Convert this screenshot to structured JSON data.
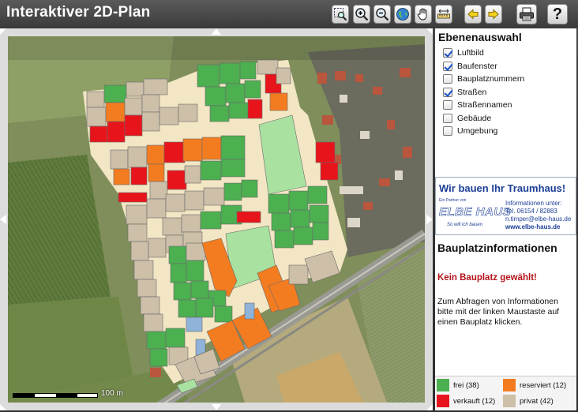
{
  "header": {
    "title": "Interaktiver 2D-Plan",
    "toolbar": [
      {
        "name": "zoom-box",
        "icon": "zoom-rectangle-icon"
      },
      {
        "name": "zoom-in",
        "icon": "zoom-in-icon"
      },
      {
        "name": "zoom-out",
        "icon": "zoom-out-icon"
      },
      {
        "name": "full-extent",
        "icon": "globe-icon"
      },
      {
        "name": "pan",
        "icon": "hand-icon"
      },
      {
        "name": "measure",
        "icon": "ruler-icon"
      },
      {
        "name": "back",
        "icon": "arrow-left-icon"
      },
      {
        "name": "forward",
        "icon": "arrow-right-icon"
      },
      {
        "name": "print",
        "icon": "printer-icon"
      },
      {
        "name": "help",
        "icon": "help-icon",
        "label": "?"
      }
    ]
  },
  "map": {
    "scale_label": "100 m",
    "colors": {
      "frei": "#4caf50",
      "verkauft": "#e8141c",
      "reserviert": "#f47c20",
      "privat": "#cdbfa8",
      "street": "#f3e6c4",
      "green": "#a9e2a0"
    }
  },
  "layers": {
    "title": "Ebenenauswahl",
    "items": [
      {
        "label": "Luftbild",
        "checked": true
      },
      {
        "label": "Baufenster",
        "checked": true
      },
      {
        "label": "Bauplatznummern",
        "checked": false
      },
      {
        "label": "Straßen",
        "checked": true
      },
      {
        "label": "Straßennamen",
        "checked": false
      },
      {
        "label": "Gebäude",
        "checked": false
      },
      {
        "label": "Umgebung",
        "checked": false
      }
    ]
  },
  "ad": {
    "headline": "Wir bauen Ihr Traumhaus!",
    "partner": "Ein Partner von",
    "brand": "ELBE HAUS",
    "slogan": "So will ich bauen",
    "contact_heading": "Informationen unter:",
    "phone": "Tel. 06154 / 82883",
    "email": "n.timper@elbe-haus.de",
    "web": "www.elbe-haus.de",
    "color": "#1c3f96"
  },
  "info": {
    "title": "Bauplatzinformationen",
    "status": "Kein Bauplatz gewählt!",
    "hint": "Zum Abfragen von Informationen bitte mit der linken Maustaste auf einen Bauplatz klicken."
  },
  "legend": {
    "items": [
      {
        "label": "frei (38)",
        "color": "#4caf50"
      },
      {
        "label": "reserviert (12)",
        "color": "#f47c20"
      },
      {
        "label": "verkauft (12)",
        "color": "#e8141c"
      },
      {
        "label": "privat (42)",
        "color": "#cdbfa8"
      }
    ]
  }
}
